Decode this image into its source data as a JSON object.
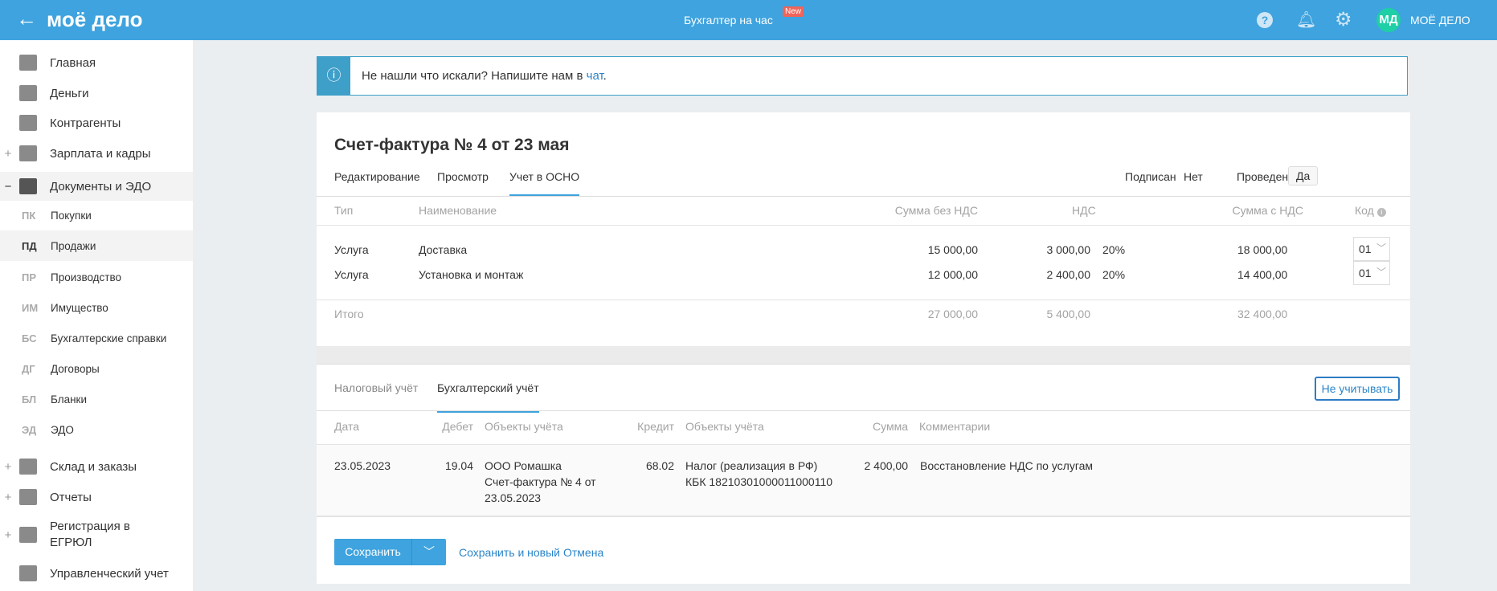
{
  "header": {
    "logo": "моё дело",
    "center": "Бухгалтер на час",
    "badge": "New",
    "avatar": "МД",
    "account": "МОЁ ДЕЛО"
  },
  "sidebar": {
    "items": [
      {
        "label": "Главная"
      },
      {
        "label": "Деньги"
      },
      {
        "label": "Контрагенты"
      },
      {
        "label": "Зарплата и кадры",
        "prefix": "+"
      },
      {
        "label": "Документы и ЭДО",
        "prefix": "−"
      }
    ],
    "sub": [
      {
        "ab": "ПК",
        "label": "Покупки"
      },
      {
        "ab": "ПД",
        "label": "Продажи"
      },
      {
        "ab": "ПР",
        "label": "Производство"
      },
      {
        "ab": "ИМ",
        "label": "Имущество"
      },
      {
        "ab": "БС",
        "label": "Бухгалтерские справки"
      },
      {
        "ab": "ДГ",
        "label": "Договоры"
      },
      {
        "ab": "БЛ",
        "label": "Бланки"
      },
      {
        "ab": "ЭД",
        "label": "ЭДО"
      }
    ],
    "more": [
      {
        "label": "Склад и заказы",
        "prefix": "+"
      },
      {
        "label": "Отчеты",
        "prefix": "+"
      },
      {
        "label": "Регистрация в ЕГРЮЛ",
        "prefix": "+"
      },
      {
        "label": "Управленческий учет",
        "prefix": ""
      }
    ]
  },
  "info": {
    "text": "Не нашли что искали? Напишите нам в ",
    "link": "чат",
    "end": "."
  },
  "doc": {
    "title": "Счет-фактура № 4 от 23 мая",
    "tabs": [
      "Редактирование",
      "Просмотр",
      "Учет в ОСНО"
    ],
    "signed_label": "Подписан",
    "signed": "Нет",
    "posted_label": "Проведен",
    "posted": "Да"
  },
  "items": {
    "headers": {
      "type": "Тип",
      "name": "Наименование",
      "net": "Сумма без НДС",
      "vat": "НДС",
      "gross": "Сумма с НДС",
      "code": "Код"
    },
    "rows": [
      {
        "type": "Услуга",
        "name": "Доставка",
        "net": "15 000,00",
        "vat": "3 000,00",
        "rate": "20%",
        "gross": "18 000,00",
        "code": "01"
      },
      {
        "type": "Услуга",
        "name": "Установка и монтаж",
        "net": "12 000,00",
        "vat": "2 400,00",
        "rate": "20%",
        "gross": "14 400,00",
        "code": "01"
      }
    ],
    "total": {
      "label": "Итого",
      "net": "27 000,00",
      "vat": "5 400,00",
      "gross": "32 400,00"
    }
  },
  "accounting": {
    "tabs": [
      "Налоговый учёт",
      "Бухгалтерский учёт"
    ],
    "ignore_btn": "Не учитывать",
    "headers": {
      "date": "Дата",
      "debit": "Дебет",
      "dobj": "Объекты учёта",
      "credit": "Кредит",
      "cobj": "Объекты учёта",
      "sum": "Сумма",
      "comment": "Комментарии"
    },
    "row": {
      "date": "23.05.2023",
      "debit": "19.04",
      "dobj1": "ООО Ромашка",
      "dobj2": "Счет-фактура № 4 от",
      "dobj3": "23.05.2023",
      "credit": "68.02",
      "cobj1": "Налог (реализация в РФ)",
      "cobj2": "КБК 18210301000011000110",
      "sum": "2 400,00",
      "comment": "Восстановление НДС по услугам"
    }
  },
  "actions": {
    "save": "Сохранить",
    "save_new": "Сохранить и новый",
    "cancel": "Отмена"
  }
}
